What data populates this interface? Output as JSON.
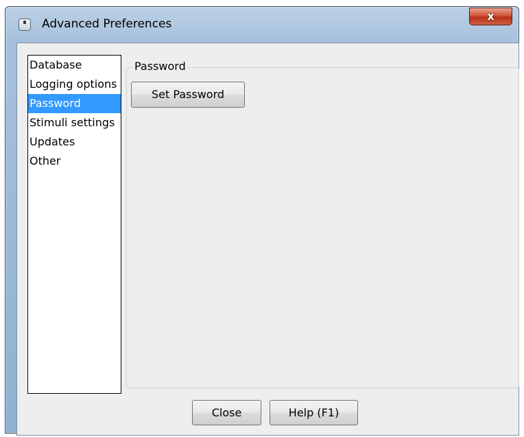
{
  "window": {
    "title": "Advanced Preferences",
    "close_label": "x",
    "accent_color": "#3399ff"
  },
  "sidebar": {
    "items": [
      {
        "label": "Database",
        "selected": false
      },
      {
        "label": "Logging options",
        "selected": false
      },
      {
        "label": "Password",
        "selected": true
      },
      {
        "label": "Stimuli settings",
        "selected": false
      },
      {
        "label": "Updates",
        "selected": false
      },
      {
        "label": "Other",
        "selected": false
      }
    ]
  },
  "panel": {
    "group_title": "Password",
    "set_password_label": "Set Password"
  },
  "footer": {
    "close_label": "Close",
    "help_label": "Help (F1)"
  }
}
